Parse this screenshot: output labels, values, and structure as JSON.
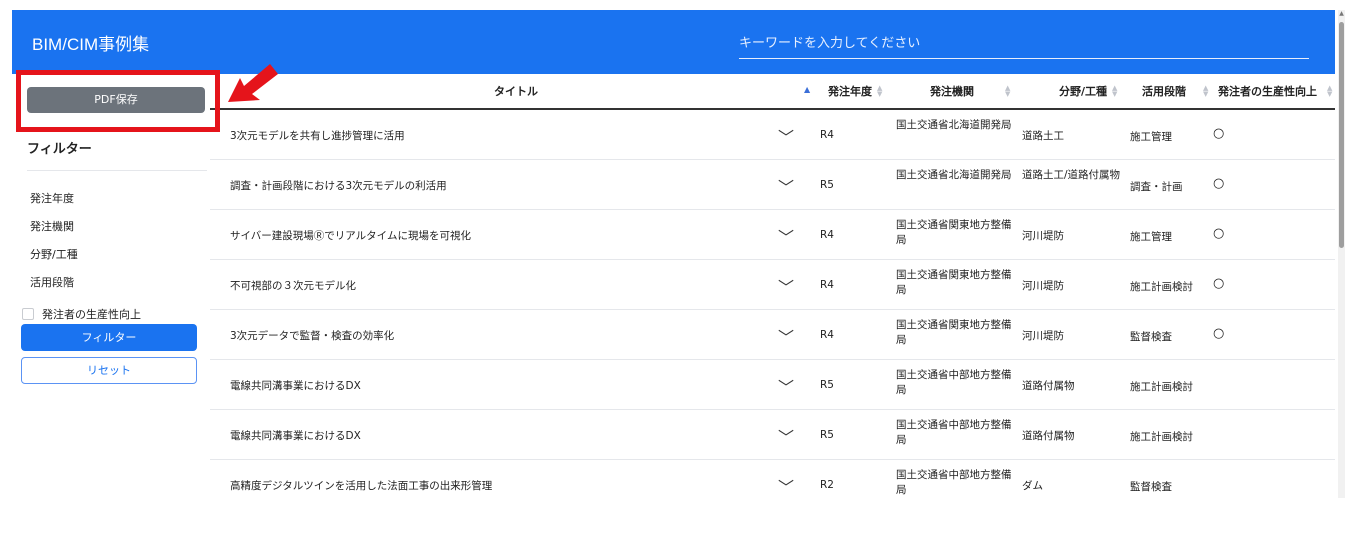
{
  "app": {
    "title": "BIM/CIM事例集"
  },
  "search": {
    "placeholder": "キーワードを入力してください"
  },
  "sidebar": {
    "pdf_button": "PDF保存",
    "filter_title": "フィルター",
    "filters": [
      "発注年度",
      "発注機関",
      "分野/工種",
      "活用段階"
    ],
    "checkbox_label": "発注者の生産性向上",
    "filter_button": "フィルター",
    "reset_button": "リセット"
  },
  "table": {
    "headers": {
      "title": "タイトル",
      "year": "発注年度",
      "org": "発注機関",
      "field": "分野/工種",
      "stage": "活用段階",
      "prod": "発注者の生産性向上"
    },
    "rows": [
      {
        "title": "3次元モデルを共有し進捗管理に活用",
        "year": "R4",
        "org": "国土交通省北海道開発局",
        "field": "道路土工",
        "stage": "施工管理",
        "prod": "○"
      },
      {
        "title": "調査・計画段階における3次元モデルの利活用",
        "year": "R5",
        "org": "国土交通省北海道開発局",
        "field": "道路土工/道路付属物",
        "stage": "調査・計画",
        "prod": "○"
      },
      {
        "title": "サイバー建設現場Ⓡでリアルタイムに現場を可視化",
        "year": "R4",
        "org": "国土交通省関東地方整備局",
        "field": "河川堤防",
        "stage": "施工管理",
        "prod": "○"
      },
      {
        "title": "不可視部の３次元モデル化",
        "year": "R4",
        "org": "国土交通省関東地方整備局",
        "field": "河川堤防",
        "stage": "施工計画検討",
        "prod": "○"
      },
      {
        "title": "3次元データで監督・検査の効率化",
        "year": "R4",
        "org": "国土交通省関東地方整備局",
        "field": "河川堤防",
        "stage": "監督検査",
        "prod": "○"
      },
      {
        "title": "電線共同溝事業におけるDX",
        "year": "R5",
        "org": "国土交通省中部地方整備局",
        "field": "道路付属物",
        "stage": "施工計画検討",
        "prod": ""
      },
      {
        "title": "電線共同溝事業におけるDX",
        "year": "R5",
        "org": "国土交通省中部地方整備局",
        "field": "道路付属物",
        "stage": "施工計画検討",
        "prod": ""
      },
      {
        "title": "高精度デジタルツインを活用した法面工事の出来形管理",
        "year": "R2",
        "org": "国土交通省中部地方整備局",
        "field": "ダム",
        "stage": "監督検査",
        "prod": ""
      }
    ]
  },
  "annotation": {
    "highlight_color": "#e5141b"
  },
  "colors": {
    "accent": "#1a73f0",
    "pdf_button": "#6c737b"
  }
}
